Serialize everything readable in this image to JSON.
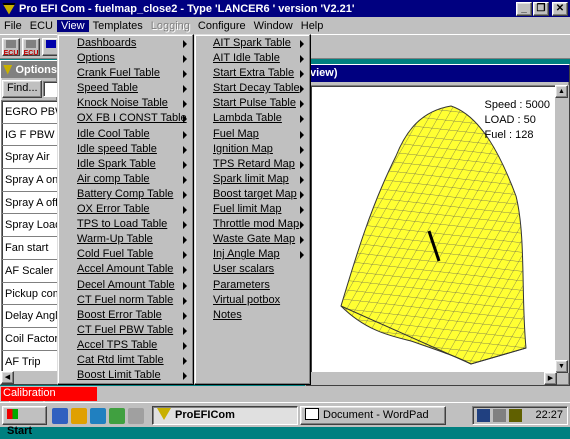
{
  "app": {
    "title": "Pro EFI Com - fuelmap_close2 - Type 'LANCER6 ' version 'V2.21'"
  },
  "menubar": [
    "File",
    "ECU",
    "View",
    "Templates",
    "Logging",
    "Configure",
    "Window",
    "Help"
  ],
  "menubar_active": "View",
  "menubar_disabled": "Logging",
  "toolbar": [
    "ECU",
    "ECU",
    "Options"
  ],
  "options_window": {
    "title": "Options",
    "find_label": "Find...",
    "items": [
      "EGRO PBW",
      "IG F PBW O",
      "Spray Air",
      "Spray A on",
      "Spray A off",
      "Spray Load",
      "Fan start",
      "AF  Scaler",
      "Pickup comp",
      "Delay Angle",
      "Coil Factor",
      "AF Trip"
    ]
  },
  "map_window": {
    "title_visible": "view)",
    "speed": "Speed : 5000",
    "load": "LOAD : 50",
    "fuel": "Fuel : 128"
  },
  "view_menu": [
    {
      "label": "Dashboards",
      "arrow": true
    },
    {
      "label": "Options",
      "arrow": true
    },
    {
      "label": "Crank Fuel Table",
      "arrow": true
    },
    {
      "label": "Speed Table",
      "arrow": true
    },
    {
      "label": "Knock Noise Table",
      "arrow": true
    },
    {
      "label": "OX FB I CONST Table",
      "arrow": true
    },
    {
      "label": "Idle Cool Table",
      "arrow": true
    },
    {
      "label": "Idle speed Table",
      "arrow": true
    },
    {
      "label": "Idle Spark Table",
      "arrow": true
    },
    {
      "label": "Air comp Table",
      "arrow": true
    },
    {
      "label": "Battery Comp Table",
      "arrow": true
    },
    {
      "label": "OX Error Table",
      "arrow": true
    },
    {
      "label": "TPS to Load Table",
      "arrow": true
    },
    {
      "label": "Warm-Up Table",
      "arrow": true
    },
    {
      "label": "Cold Fuel Table",
      "arrow": true
    },
    {
      "label": "Accel Amount Table",
      "arrow": true
    },
    {
      "label": "Decel Amount Table",
      "arrow": true
    },
    {
      "label": "CT Fuel norm Table",
      "arrow": true
    },
    {
      "label": "Boost Error Table",
      "arrow": true
    },
    {
      "label": "CT Fuel PBW Table",
      "arrow": true
    },
    {
      "label": "Accel TPS Table",
      "arrow": true
    },
    {
      "label": "Cat Rtd limt Table",
      "arrow": true
    },
    {
      "label": "Boost Limit Table",
      "arrow": true
    }
  ],
  "sub_menu": [
    {
      "label": "AIT Spark Table",
      "arrow": true
    },
    {
      "label": "AIT Idle Table",
      "arrow": true
    },
    {
      "label": "Start Extra Table",
      "arrow": true
    },
    {
      "label": "Start Decay Table",
      "arrow": true
    },
    {
      "label": "Start Pulse Table",
      "arrow": true
    },
    {
      "label": "Lambda Table",
      "arrow": true
    },
    {
      "label": "Fuel Map",
      "arrow": true
    },
    {
      "label": "Ignition Map",
      "arrow": true
    },
    {
      "label": "TPS Retard Map",
      "arrow": true
    },
    {
      "label": "Spark limit Map",
      "arrow": true
    },
    {
      "label": "Boost target Map",
      "arrow": true
    },
    {
      "label": "Fuel limit Map",
      "arrow": true
    },
    {
      "label": "Throttle mod Map",
      "arrow": true
    },
    {
      "label": "Waste Gate Map",
      "arrow": true
    },
    {
      "label": "Inj Angle Map",
      "arrow": true
    },
    {
      "label": "User scalars",
      "arrow": false
    },
    {
      "label": "Parameters",
      "arrow": false
    },
    {
      "label": "Virtual potbox",
      "arrow": false
    },
    {
      "label": "Notes",
      "arrow": false
    }
  ],
  "status": "Calibration changed",
  "taskbar": {
    "start": "Start",
    "tasks": [
      "ProEFICom",
      "Document - WordPad"
    ],
    "clock": "22:27"
  },
  "colors": {
    "desktop": "#008080",
    "titlebar": "#000080",
    "surface_fill": "#ffff33",
    "status_bg": "#ff0000"
  }
}
